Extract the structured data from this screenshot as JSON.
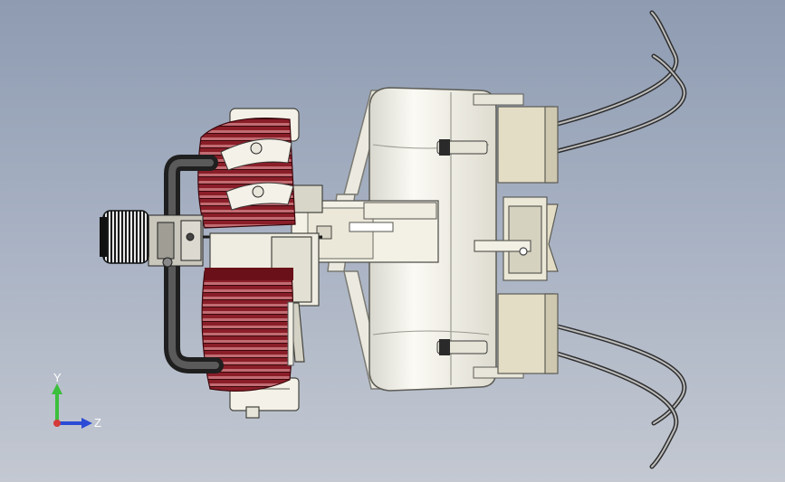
{
  "viewport": {
    "background_top": "#8e9bb1",
    "background_bottom": "#c3c8d1"
  },
  "model": {
    "body_color": "#f1f0e6",
    "shadow_color": "#c9c8bd",
    "cylinder_color": "#8a1e28",
    "cylinder_dark": "#5a0f16",
    "pipe_color": "#3a3a3a",
    "cable_color": "#444444"
  },
  "triad": {
    "y_label": "Y",
    "z_label": "Z",
    "y_color": "#3cbf3c",
    "z_color": "#2b4bd6",
    "origin_color": "#d43a3a"
  }
}
